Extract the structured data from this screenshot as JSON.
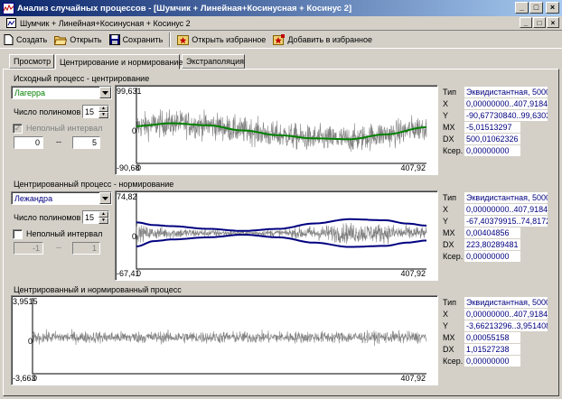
{
  "window": {
    "title": "Анализ случайных процессов - [Шумчик + Линейная+Косинусная + Косинус 2]",
    "mdi_title": "Шумчик + Линейная+Косинусная + Косинус 2",
    "caption_min": "_",
    "caption_max": "□",
    "caption_close": "×"
  },
  "toolbar": {
    "create": "Создать",
    "open": "Открыть",
    "save": "Сохранить",
    "open_fav": "Открыть избранное",
    "add_fav": "Добавить в избранное"
  },
  "tabs": [
    "Просмотр",
    "Центрирование и нормирование",
    "Экстраполяция"
  ],
  "active_tab": 1,
  "sections": [
    {
      "title": "Исходный процесс - центрирование",
      "method": "Лагерра",
      "poly_label": "Число полиномов",
      "poly_count": "15",
      "partial_label": "Неполный интервал",
      "partial_checked": true,
      "partial_disabled": true,
      "from": "0",
      "to": "5",
      "dash": "--",
      "chart": {
        "ymax_label": "99,631",
        "ymin_label": "-90,68",
        "zero_label": "0",
        "xmin_label": "0",
        "xmax_label": "407,92"
      },
      "stats": {
        "type": "Эквидистантная, 5000",
        "x": "0,00000000..407,91840",
        "y": "-90,67730840..99,6303",
        "mx": "-5,01513297",
        "dx": "500,01062326",
        "kcor": "0,00000000"
      }
    },
    {
      "title": "Центрированный процесс - нормирование",
      "method": "Лежандра",
      "poly_label": "Число полиномов",
      "poly_count": "15",
      "partial_label": "Неполный интервал",
      "partial_checked": false,
      "partial_disabled": false,
      "from": "-1",
      "to": "1",
      "dash": "--",
      "chart": {
        "ymax_label": "74,82",
        "ymin_label": "-67,41",
        "zero_label": "0",
        "xmin_label": "0",
        "xmax_label": "407,92"
      },
      "stats": {
        "type": "Эквидистантная, 5000",
        "x": "0,00000000..407,91840",
        "y": "-67,40379915..74,8172",
        "mx": "0,00404856",
        "dx": "223,80289481",
        "kcor": "0,00000000"
      }
    },
    {
      "title": "Центрированный и нормированный процесс",
      "chart": {
        "ymax_label": "3,9515",
        "ymin_label": "-3,663",
        "zero_label": "0",
        "xmin_label": "0",
        "xmax_label": "407,92"
      },
      "stats": {
        "type": "Эквидистантная, 5000",
        "x": "0,00000000..407,91840",
        "y": "-3,66213296..3,951408",
        "mx": "0,00055158",
        "dx": "1,01527238",
        "kcor": "0,00000000"
      }
    }
  ],
  "stat_labels": {
    "type": "Тип",
    "x": "X",
    "y": "Y",
    "mx": "MX",
    "dx": "DX",
    "kcor": "Ксер."
  },
  "colors": {
    "signal": "#808080",
    "trend": "#008000",
    "envelope": "#000080",
    "title_bar_start": "#0a246a",
    "title_bar_end": "#a6caf0"
  },
  "chart_data": [
    {
      "type": "line",
      "x_range": [
        0,
        407.92
      ],
      "y_range": [
        -90.68,
        99.631
      ],
      "series": [
        {
          "role": "signal",
          "noise_amplitude": 55
        },
        {
          "role": "trend",
          "x": [
            0,
            50,
            100,
            150,
            200,
            250,
            300,
            350,
            407.92
          ],
          "y": [
            3,
            10,
            5,
            -8,
            -20,
            -28,
            -30,
            -18,
            0
          ]
        }
      ]
    },
    {
      "type": "line",
      "x_range": [
        0,
        407.92
      ],
      "y_range": [
        -67.41,
        74.82
      ],
      "series": [
        {
          "role": "signal",
          "noise_amplitude": 22
        },
        {
          "role": "upper-envelope",
          "x": [
            0,
            25,
            50,
            100,
            150,
            200,
            250,
            300,
            350,
            380,
            407.92
          ],
          "y": [
            20,
            15,
            13,
            8,
            4,
            8,
            18,
            26,
            24,
            18,
            14
          ]
        },
        {
          "role": "lower-envelope",
          "x": [
            0,
            25,
            50,
            100,
            150,
            200,
            250,
            300,
            350,
            380,
            407.92
          ],
          "y": [
            -25,
            -15,
            -12,
            -8,
            -3,
            -8,
            -18,
            -26,
            -24,
            -18,
            -14
          ]
        }
      ]
    },
    {
      "type": "line",
      "x_range": [
        0,
        407.92
      ],
      "y_range": [
        -3.663,
        3.9515
      ],
      "series": [
        {
          "role": "signal",
          "noise_amplitude": 1.0
        }
      ]
    }
  ]
}
